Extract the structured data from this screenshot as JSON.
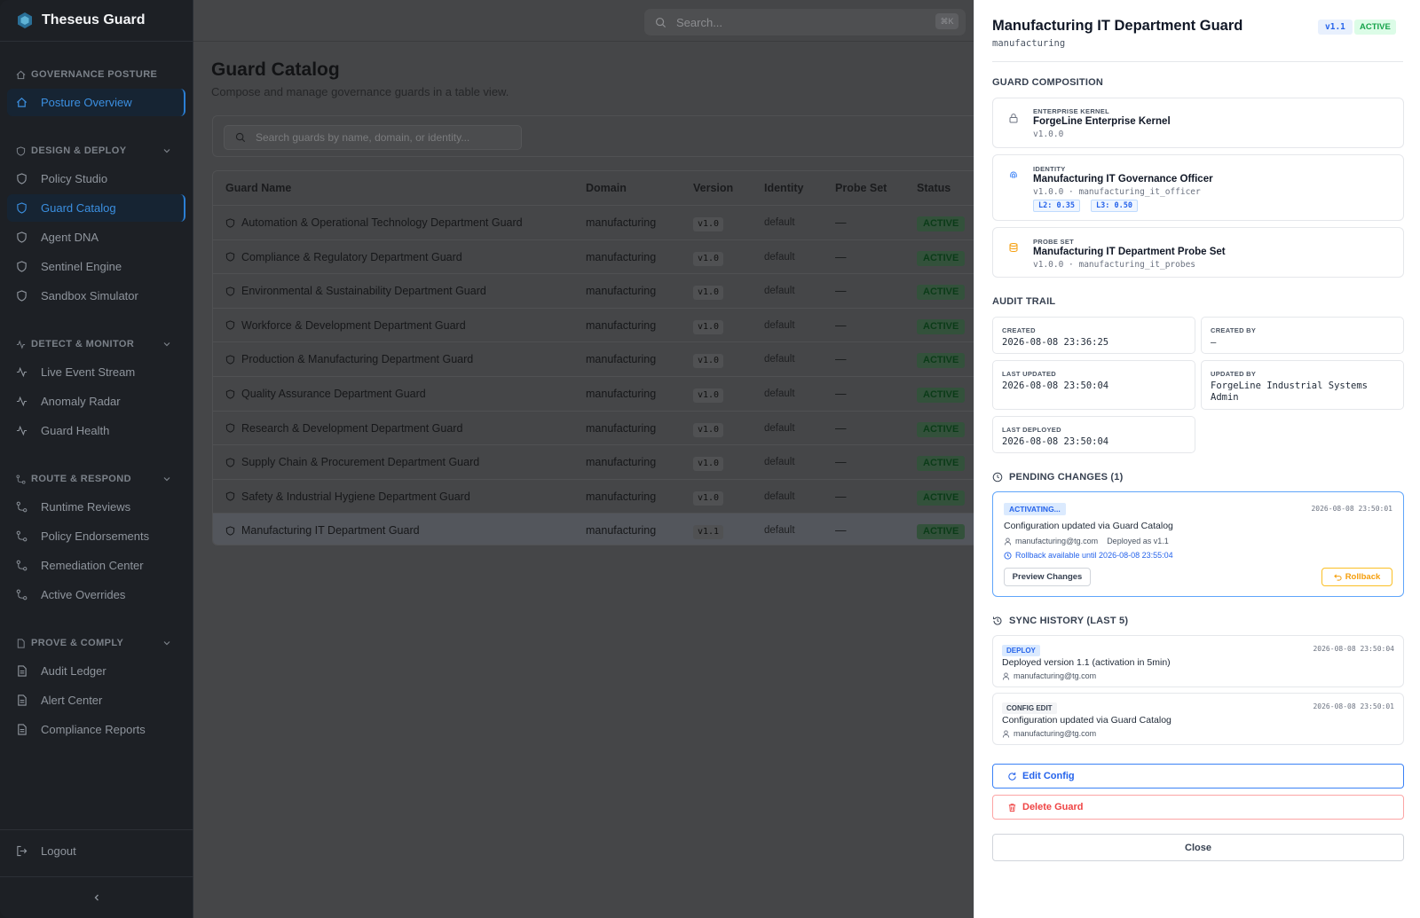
{
  "app": {
    "name": "Theseus Guard"
  },
  "sidebar": {
    "sections": [
      {
        "label": "GOVERNANCE POSTURE",
        "items": [
          {
            "label": "Posture Overview",
            "active": true
          }
        ]
      },
      {
        "label": "DESIGN & DEPLOY",
        "items": [
          {
            "label": "Policy Studio"
          },
          {
            "label": "Guard Catalog",
            "active": true
          },
          {
            "label": "Agent DNA"
          },
          {
            "label": "Sentinel Engine"
          },
          {
            "label": "Sandbox Simulator"
          }
        ]
      },
      {
        "label": "DETECT & MONITOR",
        "items": [
          {
            "label": "Live Event Stream"
          },
          {
            "label": "Anomaly Radar"
          },
          {
            "label": "Guard Health"
          }
        ]
      },
      {
        "label": "ROUTE & RESPOND",
        "items": [
          {
            "label": "Runtime Reviews"
          },
          {
            "label": "Policy Endorsements"
          },
          {
            "label": "Remediation Center"
          },
          {
            "label": "Active Overrides"
          }
        ]
      },
      {
        "label": "PROVE & COMPLY",
        "items": [
          {
            "label": "Audit Ledger"
          },
          {
            "label": "Alert Center"
          },
          {
            "label": "Compliance Reports"
          }
        ]
      }
    ],
    "logout": "Logout"
  },
  "topbar": {
    "search_placeholder": "Search...",
    "shortcut": "⌘K"
  },
  "page": {
    "title": "Guard Catalog",
    "subtitle": "Compose and manage governance guards in a table view.",
    "search_placeholder": "Search guards by name, domain, or identity..."
  },
  "table": {
    "columns": [
      "Guard Name",
      "Domain",
      "Version",
      "Identity",
      "Probe Set",
      "Status"
    ],
    "rows": [
      {
        "name": "Automation & Operational Technology Department Guard",
        "domain": "manufacturing",
        "version": "v1.0",
        "identity": "default",
        "probe": "—",
        "status": "ACTIVE"
      },
      {
        "name": "Compliance & Regulatory Department Guard",
        "domain": "manufacturing",
        "version": "v1.0",
        "identity": "default",
        "probe": "—",
        "status": "ACTIVE"
      },
      {
        "name": "Environmental & Sustainability Department Guard",
        "domain": "manufacturing",
        "version": "v1.0",
        "identity": "default",
        "probe": "—",
        "status": "ACTIVE"
      },
      {
        "name": "Workforce & Development Department Guard",
        "domain": "manufacturing",
        "version": "v1.0",
        "identity": "default",
        "probe": "—",
        "status": "ACTIVE"
      },
      {
        "name": "Production & Manufacturing Department Guard",
        "domain": "manufacturing",
        "version": "v1.0",
        "identity": "default",
        "probe": "—",
        "status": "ACTIVE"
      },
      {
        "name": "Quality Assurance Department Guard",
        "domain": "manufacturing",
        "version": "v1.0",
        "identity": "default",
        "probe": "—",
        "status": "ACTIVE"
      },
      {
        "name": "Research & Development Department Guard",
        "domain": "manufacturing",
        "version": "v1.0",
        "identity": "default",
        "probe": "—",
        "status": "ACTIVE"
      },
      {
        "name": "Supply Chain & Procurement Department Guard",
        "domain": "manufacturing",
        "version": "v1.0",
        "identity": "default",
        "probe": "—",
        "status": "ACTIVE"
      },
      {
        "name": "Safety & Industrial Hygiene Department Guard",
        "domain": "manufacturing",
        "version": "v1.0",
        "identity": "default",
        "probe": "—",
        "status": "ACTIVE"
      },
      {
        "name": "Manufacturing IT Department Guard",
        "domain": "manufacturing",
        "version": "v1.1",
        "identity": "default",
        "probe": "—",
        "status": "ACTIVE",
        "selected": true
      }
    ]
  },
  "panel": {
    "title": "Manufacturing IT Department Guard",
    "domain": "manufacturing",
    "version_badge": "v1.1",
    "status_badge": "ACTIVE",
    "composition": {
      "label": "GUARD COMPOSITION",
      "kernel": {
        "kind": "ENTERPRISE KERNEL",
        "name": "ForgeLine Enterprise Kernel",
        "meta": "v1.0.0"
      },
      "identity": {
        "kind": "IDENTITY",
        "name": "Manufacturing IT Governance Officer",
        "meta": "v1.0.0 · manufacturing_it_officer",
        "chips": [
          "L2: 0.35",
          "L3: 0.50"
        ]
      },
      "probe": {
        "kind": "PROBE SET",
        "name": "Manufacturing IT Department Probe Set",
        "meta": "v1.0.0 · manufacturing_it_probes"
      }
    },
    "audit": {
      "label": "AUDIT TRAIL",
      "created_k": "CREATED",
      "created_v": "2026-08-08 23:36:25",
      "created_by_k": "CREATED BY",
      "created_by_v": "—",
      "updated_k": "LAST UPDATED",
      "updated_v": "2026-08-08 23:50:04",
      "updated_by_k": "UPDATED BY",
      "updated_by_v": "ForgeLine Industrial Systems Admin",
      "deployed_k": "LAST DEPLOYED",
      "deployed_v": "2026-08-08 23:50:04"
    },
    "pending": {
      "label": "PENDING CHANGES (1)",
      "tag": "ACTIVATING...",
      "timestamp": "2026-08-08 23:50:01",
      "desc": "Configuration updated via Guard Catalog",
      "user": "manufacturing@tg.com",
      "deployed_as": "Deployed as v1.1",
      "rollback_note": "Rollback available until 2026-08-08 23:55:04",
      "preview_btn": "Preview Changes",
      "rollback_btn": "Rollback"
    },
    "history": {
      "label": "SYNC HISTORY (LAST 5)",
      "items": [
        {
          "tag": "DEPLOY",
          "timestamp": "2026-08-08 23:50:04",
          "desc": "Deployed version 1.1 (activation in 5min)",
          "user": "manufacturing@tg.com"
        },
        {
          "tag": "CONFIG EDIT",
          "timestamp": "2026-08-08 23:50:01",
          "desc": "Configuration updated via Guard Catalog",
          "user": "manufacturing@tg.com"
        }
      ]
    },
    "edit_btn": "Edit Config",
    "delete_btn": "Delete Guard",
    "close_btn": "Close"
  },
  "colors": {
    "accent": "#2563eb",
    "active_green": "#16a34a",
    "danger": "#ef4444",
    "warning": "#f59e0b"
  }
}
